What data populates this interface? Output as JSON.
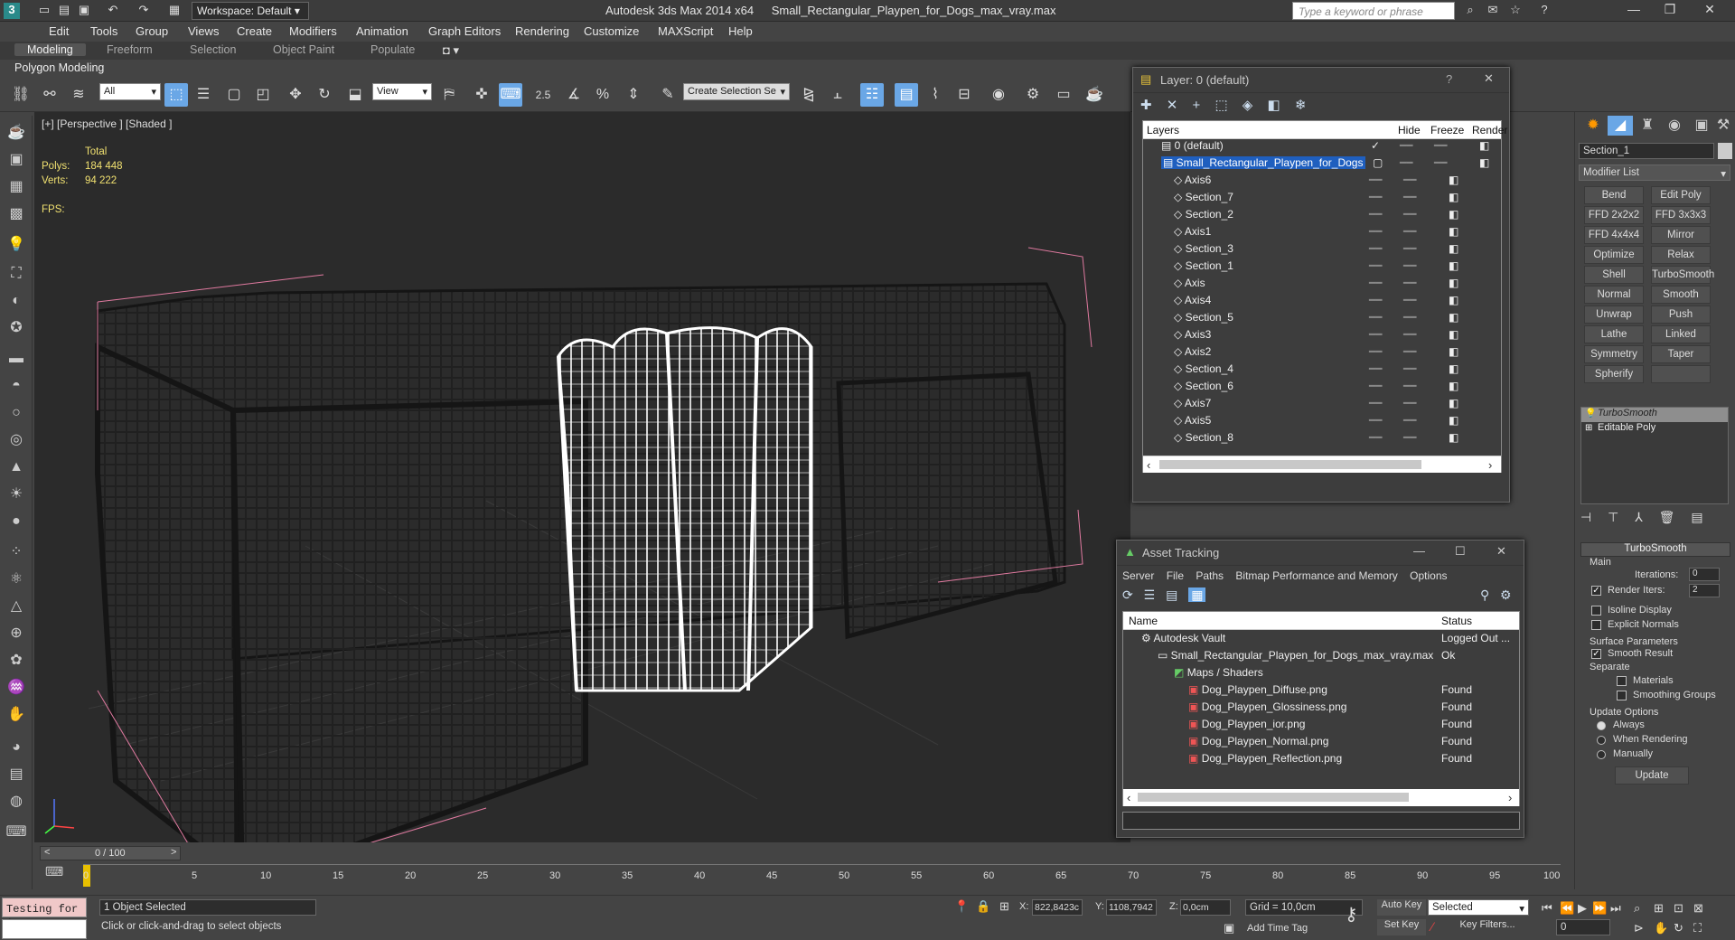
{
  "title_bar": {
    "app": "Autodesk 3ds Max 2014 x64",
    "file": "Small_Rectangular_Playpen_for_Dogs_max_vray.max",
    "workspace": "Workspace: Default",
    "search_placeholder": "Type a keyword or phrase"
  },
  "menu": [
    "Edit",
    "Tools",
    "Group",
    "Views",
    "Create",
    "Modifiers",
    "Animation",
    "Graph Editors",
    "Rendering",
    "Customize",
    "MAXScript",
    "Help"
  ],
  "ribbon_tabs": [
    "Modeling",
    "Freeform",
    "Selection",
    "Object Paint",
    "Populate"
  ],
  "ribbon_sub": "Polygon Modeling",
  "toolbar": {
    "filter": "All",
    "ref_coord": "View",
    "selection_set": "Create Selection Se",
    "snap_angle": "2.5"
  },
  "viewport": {
    "label": "[+] [Perspective ] [Shaded ]",
    "total": "Total",
    "polys_label": "Polys:",
    "polys": "184 448",
    "verts_label": "Verts:",
    "verts": "94 222",
    "fps": "FPS:"
  },
  "layer_dialog": {
    "title": "Layer: 0 (default)",
    "cols": [
      "Layers",
      "Hide",
      "Freeze",
      "Render"
    ],
    "rows": [
      "0 (default)",
      "Small_Rectangular_Playpen_for_Dogs",
      "Axis6",
      "Section_7",
      "Section_2",
      "Axis1",
      "Section_3",
      "Section_1",
      "Axis",
      "Axis4",
      "Section_5",
      "Axis3",
      "Axis2",
      "Section_4",
      "Section_6",
      "Axis7",
      "Axis5",
      "Section_8",
      "Small_Rectangular_Playpen_for_Dogs"
    ]
  },
  "asset_tracking": {
    "title": "Asset Tracking",
    "menu": [
      "Server",
      "File",
      "Paths",
      "Bitmap Performance and Memory",
      "Options"
    ],
    "cols": [
      "Name",
      "Status"
    ],
    "rows": [
      {
        "name": "Autodesk Vault",
        "status": "Logged Out ..."
      },
      {
        "name": "Small_Rectangular_Playpen_for_Dogs_max_vray.max",
        "status": "Ok"
      },
      {
        "name": "Maps / Shaders",
        "status": ""
      },
      {
        "name": "Dog_Playpen_Diffuse.png",
        "status": "Found"
      },
      {
        "name": "Dog_Playpen_Glossiness.png",
        "status": "Found"
      },
      {
        "name": "Dog_Playpen_ior.png",
        "status": "Found"
      },
      {
        "name": "Dog_Playpen_Normal.png",
        "status": "Found"
      },
      {
        "name": "Dog_Playpen_Reflection.png",
        "status": "Found"
      }
    ]
  },
  "command_panel": {
    "object_name": "Section_1",
    "modifier_list": "Modifier List",
    "buttons": [
      "Bend",
      "Edit Poly",
      "FFD 2x2x2",
      "FFD 3x3x3",
      "FFD 4x4x4",
      "Mirror",
      "Optimize",
      "Relax",
      "Shell",
      "TurboSmooth",
      "Normal",
      "Smooth",
      "Unwrap UVW",
      "Push",
      "Lathe",
      "Linked XForm",
      "Symmetry",
      "Taper",
      "Spherify",
      ""
    ],
    "stack": [
      "TurboSmooth",
      "Editable Poly"
    ],
    "rollout": "TurboSmooth",
    "main": "Main",
    "iterations_label": "Iterations:",
    "iterations": "0",
    "render_iters_label": "Render Iters:",
    "render_iters": "2",
    "isoline": "Isoline Display",
    "explicit": "Explicit Normals",
    "surface": "Surface Parameters",
    "smooth_result": "Smooth Result",
    "separate": "Separate",
    "materials": "Materials",
    "smoothing_groups": "Smoothing Groups",
    "update_options": "Update Options",
    "always": "Always",
    "when_rendering": "When Rendering",
    "manually": "Manually",
    "update": "Update"
  },
  "timeline": {
    "frame": "0 / 100",
    "ticks": [
      "0",
      "5",
      "10",
      "15",
      "20",
      "25",
      "30",
      "35",
      "40",
      "45",
      "50",
      "55",
      "60",
      "65",
      "70",
      "75",
      "80",
      "85",
      "90",
      "95",
      "100"
    ]
  },
  "status": {
    "script": "Testing for :",
    "selected": "1 Object Selected",
    "prompt": "Click or click-and-drag to select objects",
    "x_label": "X:",
    "x": "822,8423c",
    "y_label": "Y:",
    "y": "1108,7942",
    "z_label": "Z:",
    "z": "0,0cm",
    "grid": "Grid = 10,0cm",
    "add_time_tag": "Add Time Tag",
    "auto_key": "Auto Key",
    "set_key": "Set Key",
    "key_mode": "Selected",
    "key_filters": "Key Filters...",
    "frame_field": "0"
  }
}
